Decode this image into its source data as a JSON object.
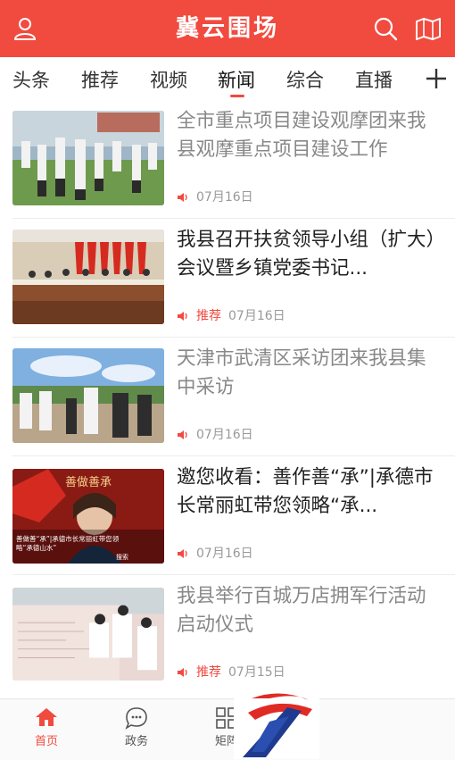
{
  "header": {
    "title": "冀云围场",
    "accent": "#f14a3f"
  },
  "tabs": [
    {
      "label": "头条"
    },
    {
      "label": "推荐"
    },
    {
      "label": "视频"
    },
    {
      "label": "新闻"
    },
    {
      "label": "综合"
    },
    {
      "label": "直播"
    }
  ],
  "active_tab": "新闻",
  "news": [
    {
      "title": "全市重点项目建设观摩团来我县观摩重点项目建设工作",
      "tag": "",
      "date": "07月16日",
      "read": true
    },
    {
      "title": "我县召开扶贫领导小组（扩大）会议暨乡镇党委书记...",
      "tag": "推荐",
      "date": "07月16日",
      "read": false
    },
    {
      "title": "天津市武清区采访团来我县集中采访",
      "tag": "",
      "date": "07月16日",
      "read": true
    },
    {
      "title": "邀您收看：善作善“承”|承德市长常丽虹带您领略“承...",
      "tag": "",
      "date": "07月16日",
      "read": false
    },
    {
      "title": "我县举行百城万店拥军行活动启动仪式",
      "tag": "推荐",
      "date": "07月15日",
      "read": true
    }
  ],
  "thumb4": {
    "banner": "善做善承",
    "caption_line1": "善做善“承”|承德市长常丽虹带您领",
    "caption_line2": "略“承德山水”",
    "source": "搜索"
  },
  "bottom_nav": [
    {
      "label": "首页",
      "icon": "home-icon",
      "active": true
    },
    {
      "label": "政务",
      "icon": "chat-icon",
      "active": false
    },
    {
      "label": "矩阵",
      "icon": "grid-icon",
      "active": false
    }
  ]
}
